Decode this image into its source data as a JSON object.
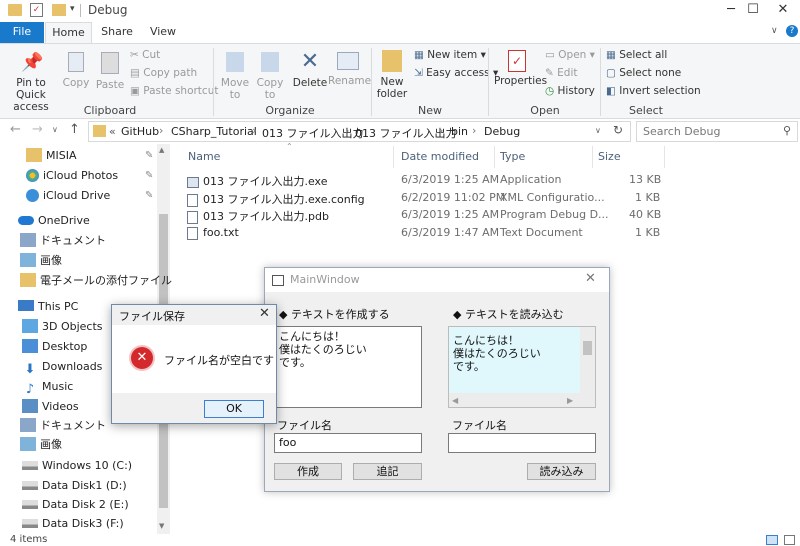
{
  "window": {
    "title": "Debug",
    "minimize_glyph": "─",
    "maximize_glyph": "☐",
    "close_glyph": "✕"
  },
  "ribbon_tabs": [
    "File",
    "Home",
    "Share",
    "View"
  ],
  "ribbon": {
    "clipboard": {
      "label": "Clipboard",
      "pin": "Pin to Quick access",
      "copy": "Copy",
      "paste": "Paste",
      "cut": "Cut",
      "copy_path": "Copy path",
      "paste_shortcut": "Paste shortcut"
    },
    "organize": {
      "label": "Organize",
      "move_to": "Move to",
      "copy_to": "Copy to",
      "delete": "Delete",
      "rename": "Rename"
    },
    "new": {
      "label": "New",
      "new_folder": "New folder",
      "new_item": "New item",
      "easy_access": "Easy access"
    },
    "open": {
      "label": "Open",
      "properties": "Properties",
      "open": "Open",
      "edit": "Edit",
      "history": "History"
    },
    "select": {
      "label": "Select",
      "select_all": "Select all",
      "select_none": "Select none",
      "invert_selection": "Invert selection"
    }
  },
  "address": {
    "prefix": "«",
    "crumbs": [
      "GitHub",
      "CSharp_Tutorial",
      "013 ファイル入出力",
      "013 ファイル入出力",
      "bin",
      "Debug"
    ],
    "search_placeholder": "Search Debug"
  },
  "nav": [
    {
      "label": "MISIA",
      "icon": "folder-icon",
      "pinned": true
    },
    {
      "label": "iCloud Photos",
      "icon": "icloud-photos-icon",
      "pinned": true
    },
    {
      "label": "iCloud Drive",
      "icon": "icloud-drive-icon",
      "pinned": true
    },
    {
      "label": "OneDrive",
      "icon": "onedrive-icon"
    },
    {
      "label": "ドキュメント",
      "icon": "documents-folder-icon"
    },
    {
      "label": "画像",
      "icon": "pictures-folder-icon"
    },
    {
      "label": "電子メールの添付ファイル",
      "icon": "folder-icon"
    },
    {
      "label": "This PC",
      "icon": "pc-icon"
    },
    {
      "label": "3D Objects",
      "icon": "3d-objects-icon"
    },
    {
      "label": "Desktop",
      "icon": "desktop-icon"
    },
    {
      "label": "Downloads",
      "icon": "downloads-icon"
    },
    {
      "label": "Music",
      "icon": "music-icon"
    },
    {
      "label": "Videos",
      "icon": "videos-icon"
    },
    {
      "label": "ドキュメント",
      "icon": "documents-folder-icon"
    },
    {
      "label": "画像",
      "icon": "pictures-folder-icon"
    },
    {
      "label": "Windows 10 (C:)",
      "icon": "drive-icon"
    },
    {
      "label": "Data Disk1 (D:)",
      "icon": "drive-icon"
    },
    {
      "label": "Data Disk 2 (E:)",
      "icon": "drive-icon"
    },
    {
      "label": "Data Disk3 (F:)",
      "icon": "drive-icon"
    }
  ],
  "columns": {
    "name": "Name",
    "date": "Date modified",
    "type": "Type",
    "size": "Size"
  },
  "files": [
    {
      "name": "013 ファイル入出力.exe",
      "date": "6/3/2019 1:25 AM",
      "type": "Application",
      "size": "13 KB",
      "icon": "exe-icon"
    },
    {
      "name": "013 ファイル入出力.exe.config",
      "date": "6/2/2019 11:02 PM",
      "type": "XML Configuratio...",
      "size": "1 KB",
      "icon": "config-file-icon"
    },
    {
      "name": "013 ファイル入出力.pdb",
      "date": "6/3/2019 1:25 AM",
      "type": "Program Debug D...",
      "size": "40 KB",
      "icon": "pdb-file-icon"
    },
    {
      "name": "foo.txt",
      "date": "6/3/2019 1:47 AM",
      "type": "Text Document",
      "size": "1 KB",
      "icon": "text-file-icon"
    }
  ],
  "status": {
    "item_count": "4 items"
  },
  "mainwindow": {
    "title": "MainWindow",
    "write_header": "◆ テキストを作成する",
    "read_header": "◆ テキストを読み込む",
    "write_text": [
      "こんにちは！",
      "僕はたくのろじい",
      "です。"
    ],
    "read_text": [
      "こんにちは！",
      "僕はたくのろじい",
      "です。"
    ],
    "write_filename_label": "ファイル名",
    "write_filename_value": "foo",
    "read_filename_label": "ファイル名",
    "read_filename_value": "",
    "create_button": "作成",
    "append_button": "追記",
    "load_button": "読み込み"
  },
  "dialog": {
    "title": "ファイル保存",
    "message": "ファイル名が空白です",
    "ok_button": "OK",
    "icon": "error-icon"
  }
}
